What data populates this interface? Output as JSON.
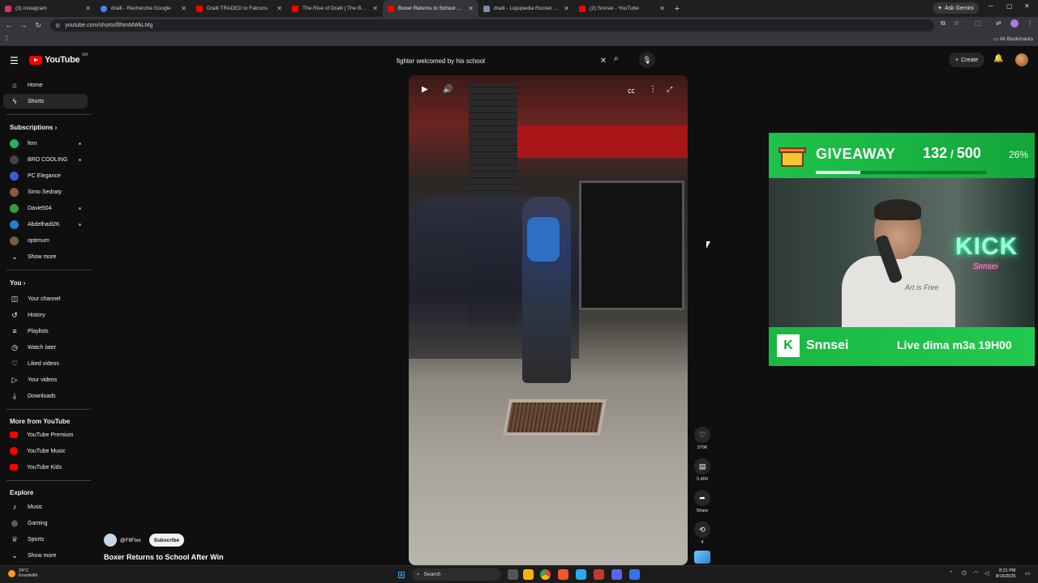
{
  "browser": {
    "tabs": [
      {
        "title": "(3) Instagram",
        "color": "#e1306c"
      },
      {
        "title": "draili - Recherche Google",
        "color": "#4285f4"
      },
      {
        "title": "Dralli TRADED to Falcons",
        "color": "#ff0000"
      },
      {
        "title": "The Rise of Dralli | The Best Ro",
        "color": "#ff0000"
      },
      {
        "title": "Boxer Returns to School After W",
        "color": "#ff0000"
      },
      {
        "title": "draili - Liquipedia Rocket Leagu",
        "color": "#7b8ea8"
      },
      {
        "title": "(2) Snnsei - YouTube",
        "color": "#ff0000"
      }
    ],
    "new_tab": "+",
    "ask_gemini": "Ask Gemini",
    "url": "youtube.com/shorts/lllNmMWkLMg",
    "all_bookmarks": "All Bookmarks"
  },
  "header": {
    "logo": "YouTube",
    "country": "MA",
    "search_value": "fighter welcomed by his school",
    "create_label": "Create"
  },
  "sidebar": {
    "main": [
      {
        "label": "Home",
        "icon": "⌂"
      },
      {
        "label": "Shorts",
        "icon": "▶"
      }
    ],
    "subscriptions_title": "Subscriptions",
    "subscriptions": [
      {
        "label": "fem",
        "color": "#1db954",
        "dot": true
      },
      {
        "label": "BRO COOLING",
        "color": "#444444",
        "dot": true
      },
      {
        "label": "PC Elegance",
        "color": "#3b5bdb",
        "dot": false
      },
      {
        "label": "Simo Sedraty",
        "color": "#8a5a3c",
        "dot": false
      },
      {
        "label": "Davie504",
        "color": "#2f9e44",
        "dot": true
      },
      {
        "label": "Abdelhadi2K",
        "color": "#1c7ed6",
        "dot": true
      },
      {
        "label": "optimum",
        "color": "#7a5c3c",
        "dot": false
      }
    ],
    "show_more_1": "Show more",
    "you_title": "You",
    "you": [
      {
        "label": "Your channel",
        "icon": "◫"
      },
      {
        "label": "History",
        "icon": "↺"
      },
      {
        "label": "Playlists",
        "icon": "≡"
      },
      {
        "label": "Watch later",
        "icon": "◷"
      },
      {
        "label": "Liked videos",
        "icon": "♡"
      },
      {
        "label": "Your videos",
        "icon": "▷"
      },
      {
        "label": "Downloads",
        "icon": "⤓"
      }
    ],
    "more_title": "More from YouTube",
    "more": [
      {
        "label": "YouTube Premium"
      },
      {
        "label": "YouTube Music"
      },
      {
        "label": "YouTube Kids"
      }
    ],
    "explore_title": "Explore",
    "explore": [
      {
        "label": "Music",
        "icon": "♪"
      },
      {
        "label": "Gaming",
        "icon": "◎"
      },
      {
        "label": "Sports",
        "icon": "♕"
      }
    ],
    "show_more_2": "Show more"
  },
  "video": {
    "channel": "@FitFixx",
    "subscribe": "Subscribe",
    "title": "Boxer Returns to School After Win",
    "likes": "370K",
    "comments": "5,400",
    "share": "Share",
    "remix": "4"
  },
  "overlay": {
    "giveaway": "GIVEAWAY",
    "count": "132",
    "total": "500",
    "percent": "26%",
    "progress": 0.264,
    "neon": "KICK",
    "neon_sub": "Snnsei",
    "shirt_text": "Art is Free",
    "kick_logo": "K",
    "streamer": "Snnsei",
    "schedule": "Live dima m3a 19H00"
  },
  "taskbar": {
    "temp": "24°C",
    "weather": "Ensoleillé",
    "search": "Search",
    "time": "8:21 PM",
    "date": "8/16/2025"
  }
}
